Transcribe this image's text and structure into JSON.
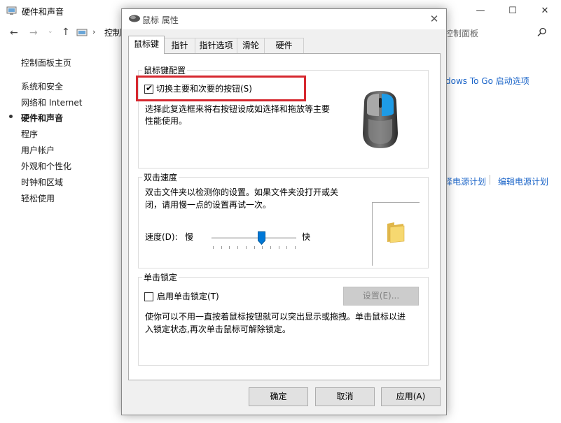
{
  "control_panel": {
    "title": "硬件和声音",
    "address_label": "控制",
    "search_placeholder": "控制面板",
    "sidebar": [
      {
        "label": "控制面板主页"
      },
      {
        "label": "系统和安全"
      },
      {
        "label": "网络和 Internet"
      },
      {
        "label": "硬件和声音",
        "active": true
      },
      {
        "label": "程序"
      },
      {
        "label": "用户帐户"
      },
      {
        "label": "外观和个性化"
      },
      {
        "label": "时钟和区域"
      },
      {
        "label": "轻松使用"
      }
    ],
    "links": {
      "windows_to_go": "dows To Go 启动选项",
      "power_plan": "择电源计划",
      "edit_power_plan": "编辑电源计划"
    },
    "window_controls": {
      "minimize": "—",
      "maximize": "☐",
      "close": "✕"
    }
  },
  "dialog": {
    "title": "鼠标 属性",
    "close_glyph": "✕",
    "tabs": [
      {
        "label": "鼠标键",
        "active": true
      },
      {
        "label": "指针"
      },
      {
        "label": "指针选项"
      },
      {
        "label": "滑轮"
      },
      {
        "label": "硬件"
      }
    ],
    "button_config": {
      "group_label": "鼠标键配置",
      "checkbox_label": "切换主要和次要的按钮(S)",
      "checked": true,
      "description_line1": "选择此复选框来将右按钮设成如选择和拖放等主要",
      "description_line2": "性能使用。"
    },
    "double_click": {
      "group_label": "双击速度",
      "description_line1": "双击文件夹以检测你的设置。如果文件夹没打开或关",
      "description_line2": "闭，请用慢一点的设置再试一次。",
      "speed_label": "速度(D):",
      "slow_label": "慢",
      "fast_label": "快",
      "speed_value": 0.6
    },
    "click_lock": {
      "group_label": "单击锁定",
      "checkbox_label": "启用单击锁定(T)",
      "checked": false,
      "settings_button": "设置(E)...",
      "description_line1": "使你可以不用一直按着鼠标按钮就可以突出显示或拖拽。单击鼠标以进",
      "description_line2": "入锁定状态,再次单击鼠标可解除锁定。"
    },
    "buttons": {
      "ok": "确定",
      "cancel": "取消",
      "apply": "应用(A)"
    },
    "colors": {
      "highlight": "#d6282f",
      "mouse_button_accent": "#1e9be6"
    }
  }
}
